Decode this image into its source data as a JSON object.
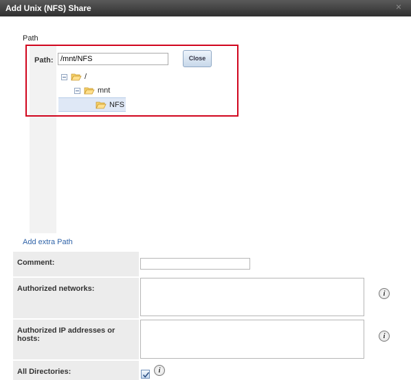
{
  "dialog": {
    "title": "Add Unix (NFS) Share"
  },
  "path_section": {
    "heading": "Path",
    "path_label": "Path:",
    "path_value": "/mnt/NFS",
    "close_label": "Close",
    "tree": [
      {
        "label": "/"
      },
      {
        "label": "mnt"
      },
      {
        "label": "NFS"
      }
    ],
    "add_extra_path": "Add extra Path"
  },
  "form": {
    "comment_label": "Comment:",
    "comment_value": "",
    "networks_label": "Authorized networks:",
    "networks_value": "",
    "hosts_label": "Authorized IP addresses or hosts:",
    "hosts_value": "",
    "all_dirs_label": "All Directories:",
    "all_dirs_checked": true
  },
  "icons": {
    "close_dialog": "close-x-icon",
    "folder": "folder-open-icon",
    "collapse": "tree-collapse-icon",
    "info": "info-icon"
  },
  "colors": {
    "highlight_border": "#d0021b",
    "link": "#2f63a8",
    "titlebar": "#3a3a3a"
  }
}
